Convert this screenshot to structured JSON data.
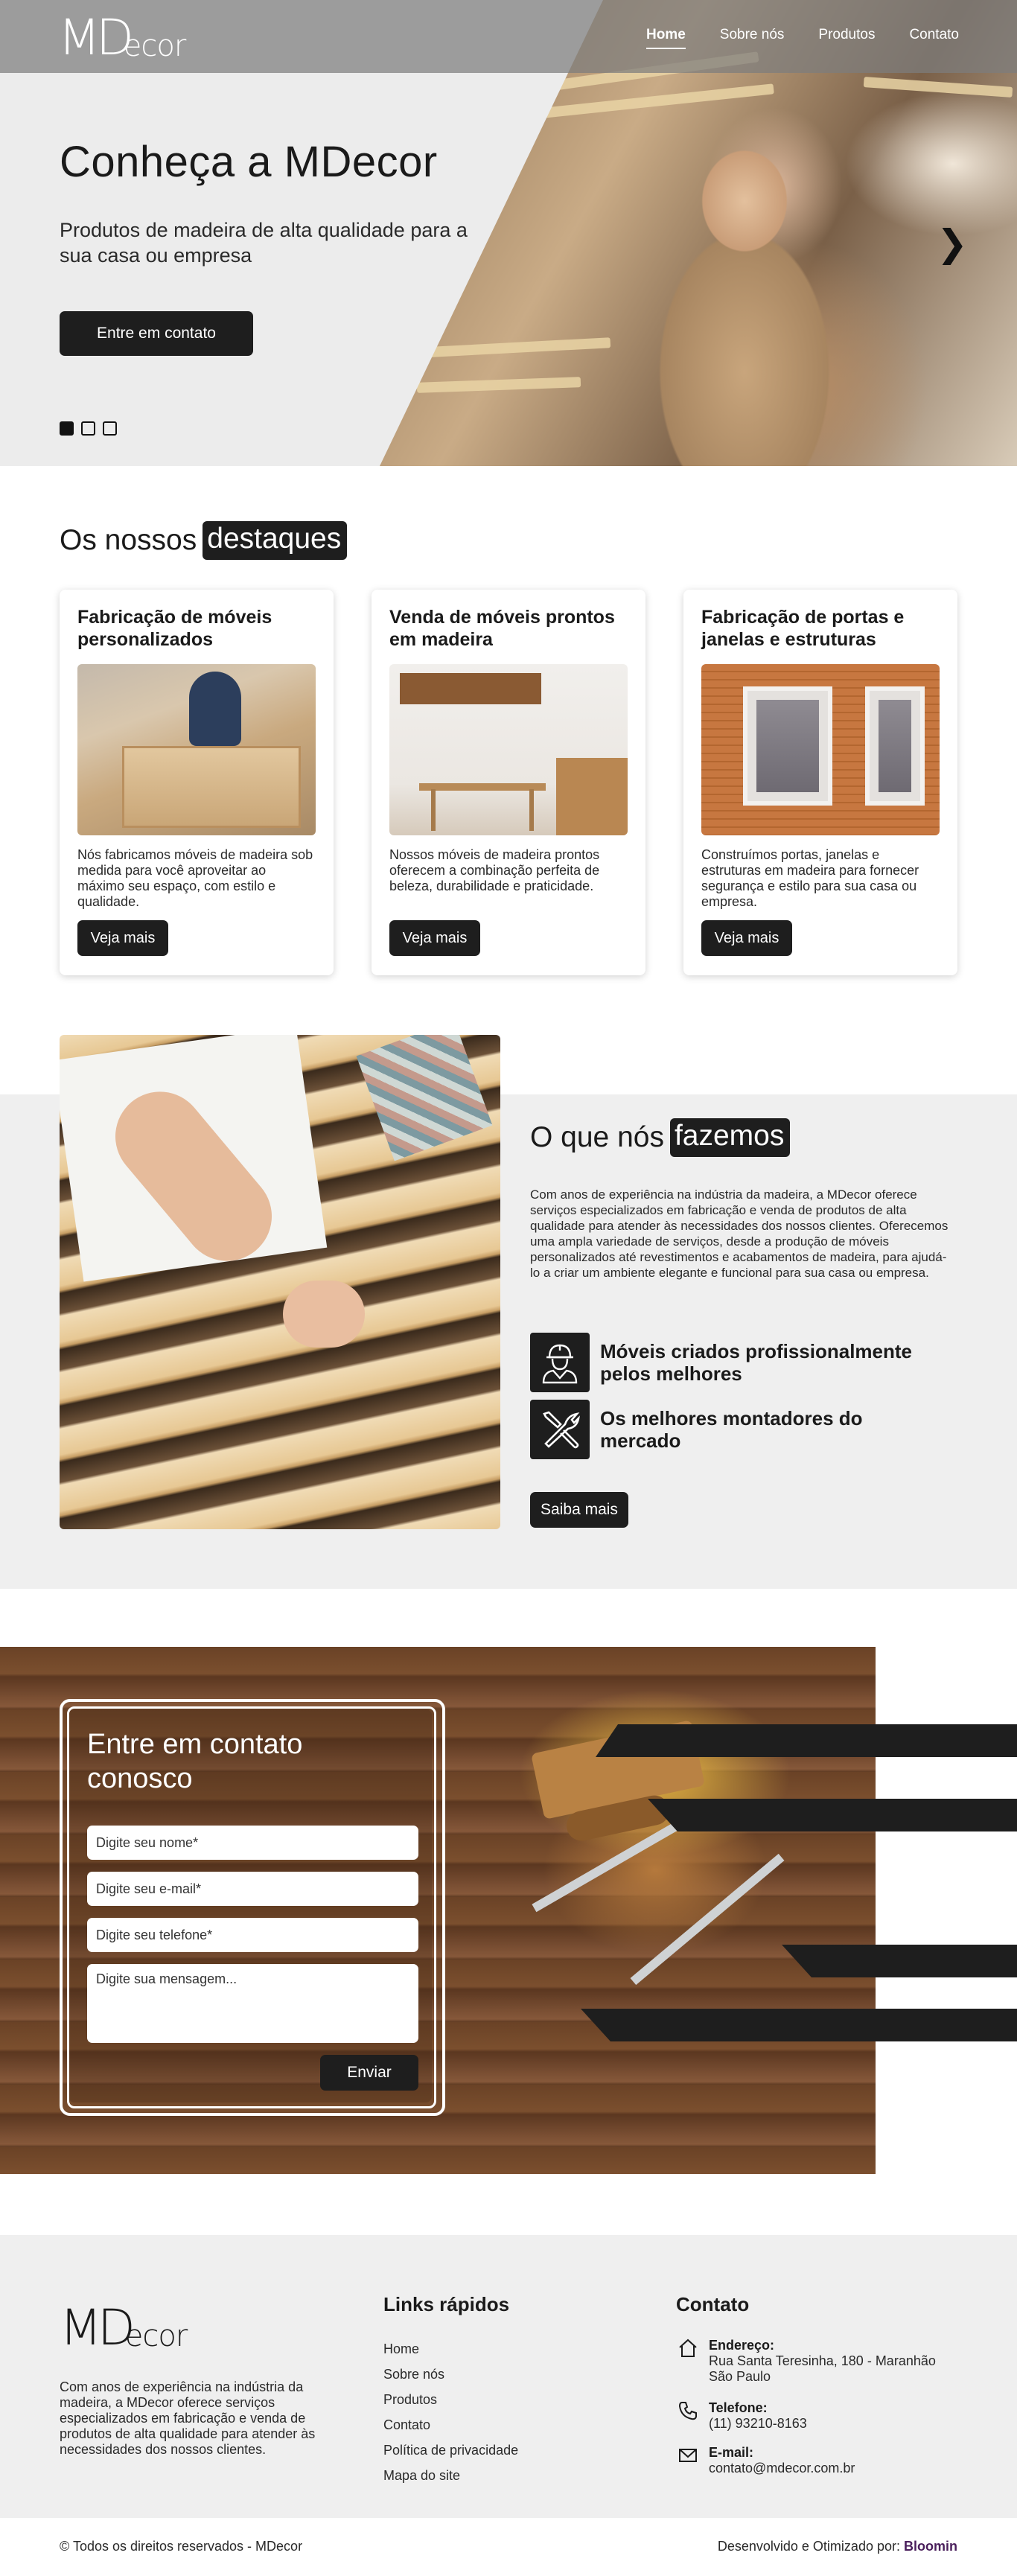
{
  "header": {
    "logo_main": "MD",
    "logo_rest": "ecor",
    "nav": [
      "Home",
      "Sobre nós",
      "Produtos",
      "Contato"
    ],
    "active_nav": "Home"
  },
  "hero": {
    "title": "Conheça a MDecor",
    "subtitle": "Produtos de madeira de alta qualidade para a sua casa ou empresa",
    "cta": "Entre em contato",
    "next_icon": "chevron-right-icon",
    "slides": 3,
    "active_slide": 1
  },
  "highlights": {
    "title_plain": "Os nossos",
    "title_mark": "destaques",
    "cards": [
      {
        "title": "Fabricação de móveis personalizados",
        "text": "Nós fabricamos móveis de madeira sob medida para você aproveitar ao máximo seu espaço, com estilo e qualidade.",
        "button": "Veja mais"
      },
      {
        "title": "Venda de móveis prontos em madeira",
        "text": "Nossos móveis de madeira prontos oferecem a combinação perfeita de beleza, durabilidade e praticidade.",
        "button": "Veja mais"
      },
      {
        "title": "Fabricação de portas e janelas e estruturas",
        "text": "Construímos portas, janelas e estruturas em madeira para fornecer segurança e estilo para sua casa ou empresa.",
        "button": "Veja mais"
      }
    ]
  },
  "whatwedo": {
    "title_plain": "O que nós",
    "title_mark": "fazemos",
    "description": "Com anos de experiência na indústria da madeira, a MDecor oferece serviços especializados em fabricação e venda de produtos de alta qualidade para atender às necessidades dos nossos clientes. Oferecemos uma ampla variedade de serviços, desde a produção de móveis personalizados até revestimentos e acabamentos de madeira, para ajudá-lo a criar um ambiente elegante e funcional para sua casa ou empresa.",
    "features": [
      {
        "icon": "worker-icon",
        "text": "Móveis criados profissionalmente pelos melhores"
      },
      {
        "icon": "tools-icon",
        "text": "Os melhores montadores do mercado"
      }
    ],
    "button": "Saiba mais"
  },
  "contact_form": {
    "title": "Entre em contato conosco",
    "name_placeholder": "Digite seu nome*",
    "email_placeholder": "Digite seu e-mail*",
    "phone_placeholder": "Digite seu telefone*",
    "message_placeholder": "Digite sua mensagem...",
    "submit": "Enviar"
  },
  "footer": {
    "description": "Com anos de experiência na indústria da madeira, a MDecor oferece serviços especializados em fabricação e venda de produtos de alta qualidade para atender às necessidades dos nossos clientes.",
    "links_title": "Links rápidos",
    "links": [
      "Home",
      "Sobre nós",
      "Produtos",
      "Contato",
      "Política de privacidade",
      "Mapa do site"
    ],
    "contact_title": "Contato",
    "address_label": "Endereço:",
    "address": "Rua Santa Teresinha, 180 - Maranhão São Paulo",
    "phone_label": "Telefone:",
    "phone": "(11) 93210-8163",
    "email_label": "E-mail:",
    "email": "contato@mdecor.com.br",
    "copyright": "© Todos os direitos reservados - MDecor",
    "dev_prefix": "Desenvolvido e Otimizado por:",
    "dev_name": "Bloomin",
    "brand_color": "#4a1f5c"
  }
}
